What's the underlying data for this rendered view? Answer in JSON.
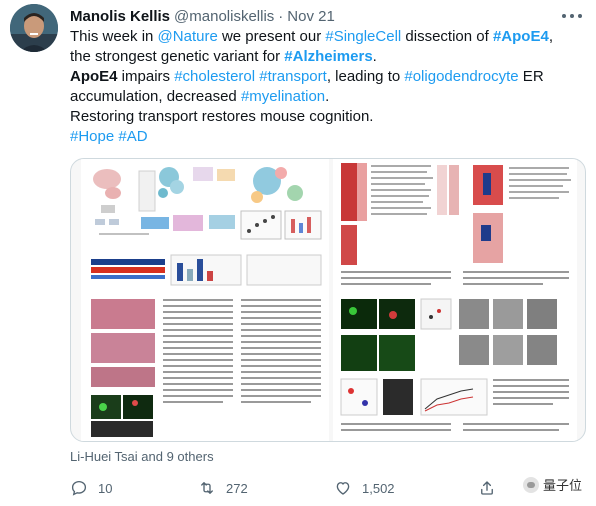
{
  "author": {
    "name": "Manolis Kellis",
    "handle": "@manoliskellis",
    "separator": "·",
    "time": "Nov 21"
  },
  "tweet": {
    "line1": {
      "t1": "This week in ",
      "h1": "@Nature",
      "t2": " we present our ",
      "h2": "#SingleCell",
      "t3": " dissection of ",
      "h3": "#ApoE4",
      "t4": ","
    },
    "line2": {
      "t1": "the strongest genetic variant for ",
      "h1": "#Alzheimers",
      "t2": "."
    },
    "line3": {
      "t1": "ApoE4",
      "t2": " impairs ",
      "h1": "#cholesterol",
      "t3": " ",
      "h2": "#transport",
      "t4": ", leading to ",
      "h3": "#oligodendrocyte",
      "t5": " ER"
    },
    "line4": {
      "t1": "accumulation, decreased ",
      "h1": "#myelination",
      "t2": "."
    },
    "line5": {
      "t1": "Restoring transport restores mouse cognition."
    },
    "line6": {
      "h1": "#Hope",
      "t1": " ",
      "h2": "#AD"
    }
  },
  "tagged": "Li-Huei Tsai and 9 others",
  "actions": {
    "reply_count": "10",
    "retweet_count": "272",
    "like_count": "1,502"
  },
  "watermark": "量子位",
  "icons": [
    "more-icon",
    "reply-icon",
    "retweet-icon",
    "like-icon",
    "share-icon"
  ],
  "colors": {
    "link": "#1d9bf0",
    "secondary": "#536471",
    "text": "#0f1419"
  }
}
